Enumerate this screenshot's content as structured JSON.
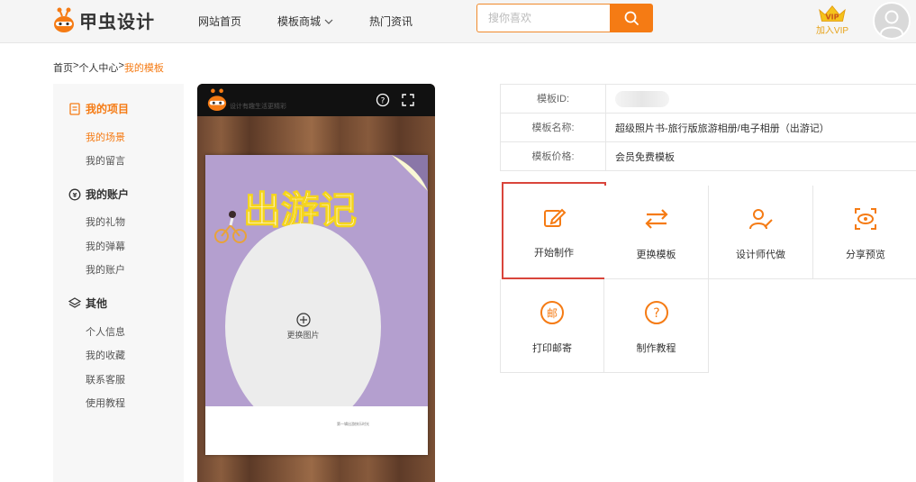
{
  "header": {
    "logo_text": "甲虫设计",
    "nav": [
      {
        "label": "网站首页"
      },
      {
        "label": "模板商城"
      },
      {
        "label": "热门资讯"
      }
    ],
    "search_placeholder": "搜你喜欢",
    "vip_badge": "VIP",
    "vip_label": "加入VIP"
  },
  "breadcrumb": {
    "items": [
      "首页",
      "个人中心",
      "我的模板"
    ],
    "separator": ">"
  },
  "sidebar": {
    "groups": [
      {
        "title": "我的项目",
        "icon": "document-icon",
        "items": [
          "我的场景",
          "我的留言"
        ]
      },
      {
        "title": "我的账户",
        "icon": "wallet-icon",
        "items": [
          "我的礼物",
          "我的弹幕",
          "我的账户"
        ]
      },
      {
        "title": "其他",
        "icon": "layers-icon",
        "items": [
          "个人信息",
          "我的收藏",
          "联系客服",
          "使用教程"
        ]
      }
    ]
  },
  "preview": {
    "tagline": "设计有趣生活更精彩",
    "page_title": "出游记",
    "photo_label": "更换图片",
    "caption": "第一辑出游快乐时光"
  },
  "info": {
    "rows": [
      {
        "label": "模板ID:",
        "value": ""
      },
      {
        "label": "模板名称:",
        "value": "超级照片书-旅行版旅游相册/电子相册（出游记）"
      },
      {
        "label": "模板价格:",
        "value": "会员免费模板"
      }
    ]
  },
  "actions": [
    {
      "label": "开始制作",
      "icon": "edit-icon"
    },
    {
      "label": "更换模板",
      "icon": "swap-icon"
    },
    {
      "label": "设计师代做",
      "icon": "designer-icon"
    },
    {
      "label": "分享预览",
      "icon": "eye-icon"
    },
    {
      "label": "打印邮寄",
      "icon": "mail-icon",
      "glyph": "邮"
    },
    {
      "label": "制作教程",
      "icon": "help-icon",
      "glyph": "?"
    }
  ],
  "colors": {
    "accent": "#f57b14",
    "highlight_border": "#d9453b",
    "page_purple": "#b49fcf",
    "vip_gold": "#e7a31a"
  }
}
